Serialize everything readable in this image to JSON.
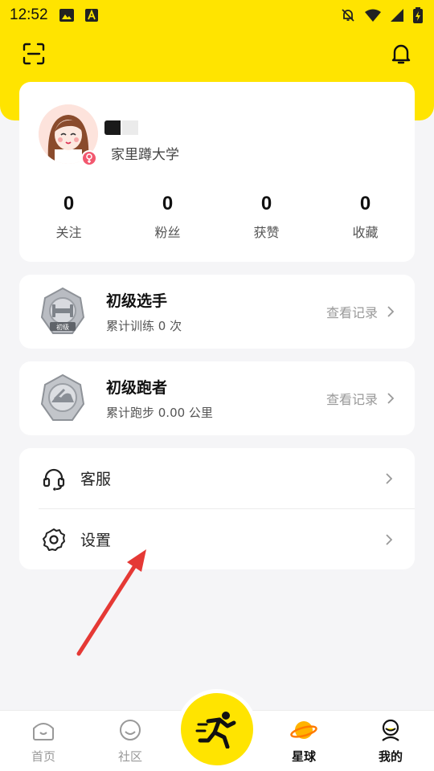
{
  "status_bar": {
    "time": "12:52"
  },
  "profile": {
    "school": "家里蹲大学",
    "stats": [
      {
        "value": "0",
        "label": "关注"
      },
      {
        "value": "0",
        "label": "粉丝"
      },
      {
        "value": "0",
        "label": "获赞"
      },
      {
        "value": "0",
        "label": "收藏"
      }
    ]
  },
  "badges": [
    {
      "title": "初级选手",
      "subtitle": "累计训练 0 次",
      "link": "查看记录",
      "icon": "dumbbell-medal-icon",
      "medal_text": "初级"
    },
    {
      "title": "初级跑者",
      "subtitle": "累计跑步 0.00 公里",
      "link": "查看记录",
      "icon": "running-shoe-medal-icon"
    }
  ],
  "menu": [
    {
      "label": "客服",
      "icon": "headset-icon"
    },
    {
      "label": "设置",
      "icon": "gear-icon"
    }
  ],
  "tabbar": {
    "tabs": [
      {
        "label": "首页",
        "icon": "home-icon"
      },
      {
        "label": "社区",
        "icon": "smile-icon"
      },
      {
        "label": "星球",
        "icon": "planet-icon"
      },
      {
        "label": "我的",
        "icon": "mine-icon"
      }
    ],
    "active": "我的"
  },
  "colors": {
    "brand_yellow": "#ffe400",
    "annotation_red": "#e53935"
  }
}
